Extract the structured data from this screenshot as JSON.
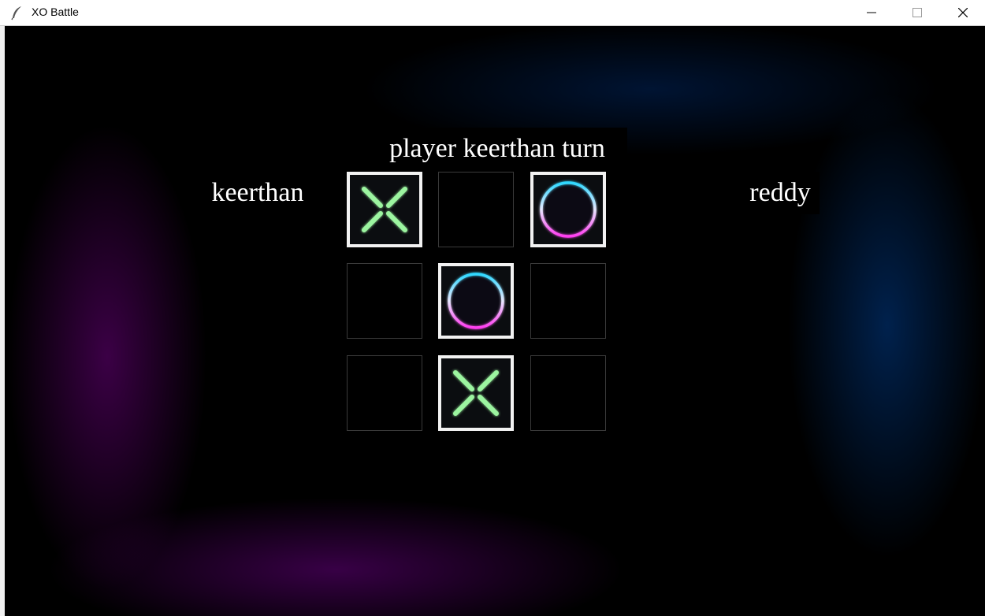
{
  "window": {
    "title": "XO Battle",
    "controls": [
      "minimize",
      "maximize",
      "close"
    ]
  },
  "game": {
    "turn_text": "player keerthan turn",
    "player1_name": "keerthan",
    "player2_name": "reddy",
    "board": [
      [
        "X",
        "",
        "O"
      ],
      [
        "",
        "O",
        ""
      ],
      [
        "",
        "X",
        ""
      ]
    ]
  },
  "colors": {
    "frame_left": "#c21bff",
    "frame_right": "#1e9bff",
    "x_mark": "#9cf5a0",
    "o_mark_top": "#2fd8ff",
    "o_mark_bottom": "#ff3df0",
    "cell_border": "#f2f2f2"
  },
  "icons": {
    "app": "feather-icon",
    "x_piece": "x-mark-icon",
    "o_piece": "o-ring-icon"
  }
}
